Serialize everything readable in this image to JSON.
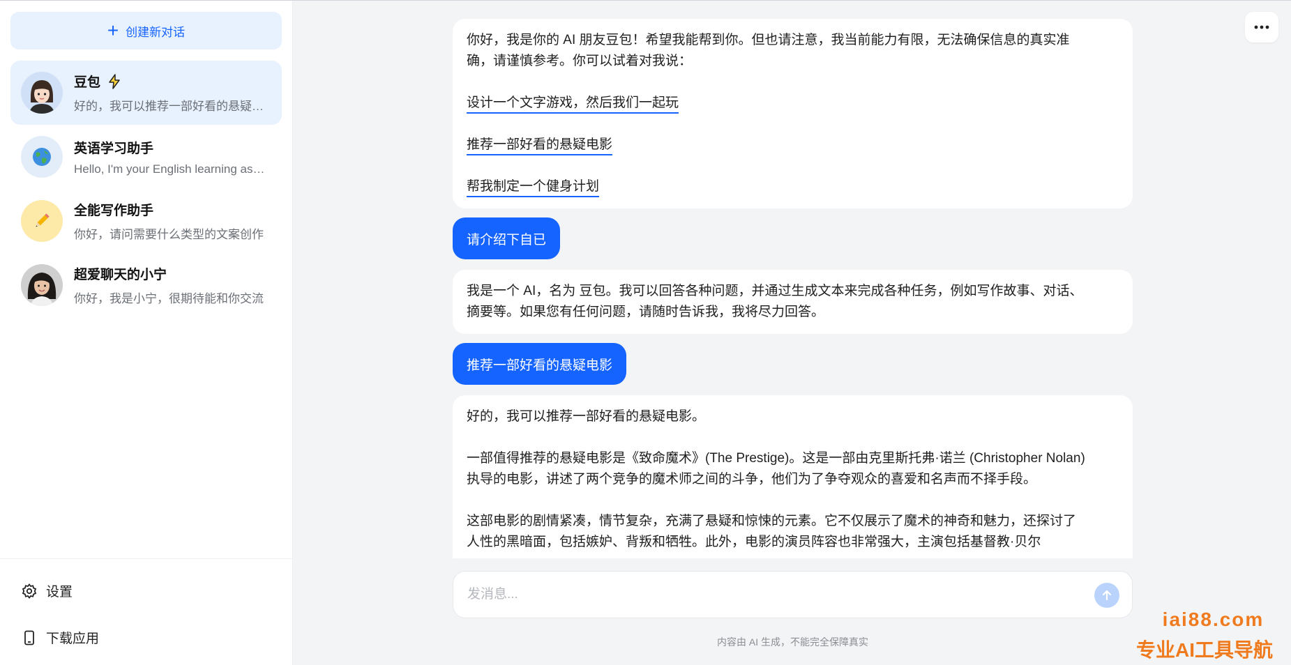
{
  "sidebar": {
    "new_chat_label": "创建新对话",
    "conversations": [
      {
        "name": "豆包",
        "preview": "好的，我可以推荐一部好看的悬疑电影",
        "avatar": "girl-avatar",
        "badge": "lightning-icon"
      },
      {
        "name": "英语学习助手",
        "preview": "Hello, I'm your English learning assistant",
        "avatar": "globe-icon"
      },
      {
        "name": "全能写作助手",
        "preview": "你好，请问需要什么类型的文案创作",
        "avatar": "pencil-icon"
      },
      {
        "name": "超爱聊天的小宁",
        "preview": "你好，我是小宁，很期待能和你交流",
        "avatar": "woman-avatar"
      }
    ],
    "settings_label": "设置",
    "download_label": "下载应用"
  },
  "chat": {
    "welcome": {
      "intro_line1": "你好，我是你的 AI 朋友豆包！希望我能帮到你。但也请注意，我当前能力有限，无法确保信息的真实准",
      "intro_line2": "确，请谨慎参考。你可以试着对我说：",
      "suggestions": [
        "设计一个文字游戏，然后我们一起玩",
        "推荐一部好看的悬疑电影",
        "帮我制定一个健身计划"
      ]
    },
    "user_msg_1": "请介绍下自已",
    "bot_reply_1": {
      "line1": "我是一个 AI，名为 豆包。我可以回答各种问题，并通过生成文本来完成各种任务，例如写作故事、对话、",
      "line2": "摘要等。如果您有任何问题，请随时告诉我，我将尽力回答。"
    },
    "user_msg_2": "推荐一部好看的悬疑电影",
    "bot_reply_2": {
      "p1": "好的，我可以推荐一部好看的悬疑电影。",
      "p2_line1": "一部值得推荐的悬疑电影是《致命魔术》(The Prestige)。这是一部由克里斯托弗·诺兰 (Christopher Nolan)",
      "p2_line2": "执导的电影，讲述了两个竞争的魔术师之间的斗争，他们为了争夺观众的喜爱和名声而不择手段。",
      "p3_line1": "这部电影的剧情紧凑，情节复杂，充满了悬疑和惊悚的元素。它不仅展示了魔术的神奇和魅力，还探讨了",
      "p3_line2": "人性的黑暗面，包括嫉妒、背叛和牺牲。此外，电影的演员阵容也非常强大，主演包括基督教·贝尔"
    }
  },
  "input": {
    "placeholder": "发消息..."
  },
  "disclaimer": "内容由 AI 生成，不能完全保障真实",
  "watermark": {
    "domain": "iai88.com",
    "slogan": "专业AI工具导航"
  },
  "colors": {
    "accent": "#1664ff",
    "active_bg": "#e8f1fe",
    "watermark": "#f07b1e"
  }
}
